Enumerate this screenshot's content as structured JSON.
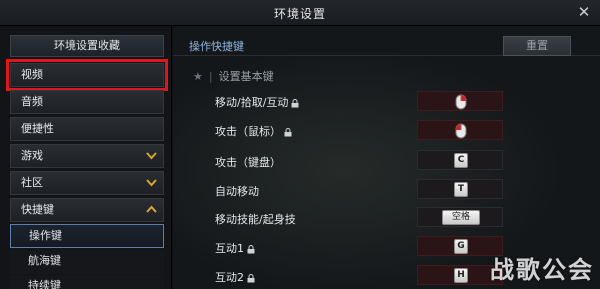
{
  "window": {
    "title": "环境设置",
    "close_icon": "close-icon"
  },
  "sidebar": {
    "header": "环境设置收藏",
    "items": [
      {
        "label": "视频",
        "highlighted": true
      },
      {
        "label": "音频"
      },
      {
        "label": "便捷性"
      },
      {
        "label": "游戏",
        "chevron": "chevron-down-icon"
      },
      {
        "label": "社区",
        "chevron": "chevron-down-icon"
      },
      {
        "label": "快捷键",
        "chevron": "chevron-up-icon"
      }
    ],
    "sub_items": [
      {
        "label": "操作键",
        "active": true
      },
      {
        "label": "航海键"
      },
      {
        "label": "持续键"
      }
    ]
  },
  "main": {
    "header": "操作快捷键",
    "reset_label": "重置",
    "section_title": "设置基本键",
    "rows": [
      {
        "label": "移动/拾取/互动",
        "locked": true,
        "key": "mouse-right-icon",
        "slot_color": "red"
      },
      {
        "label": "攻击（鼠标）",
        "locked": true,
        "key": "mouse-left-icon",
        "slot_color": "red"
      },
      {
        "label": "攻击（键盘）",
        "locked": false,
        "key": "C"
      },
      {
        "label": "自动移动",
        "locked": false,
        "key": "T"
      },
      {
        "label": "移动技能/起身技",
        "locked": false,
        "key": "空格"
      },
      {
        "label": "互动1",
        "locked": true,
        "key": "G"
      },
      {
        "label": "互动2",
        "locked": true,
        "key": "H"
      }
    ]
  },
  "watermark": "战歌公会",
  "colors": {
    "highlight_border": "#e0161c",
    "chevron": "#d8a72a",
    "header_text": "#8fb5dd"
  }
}
